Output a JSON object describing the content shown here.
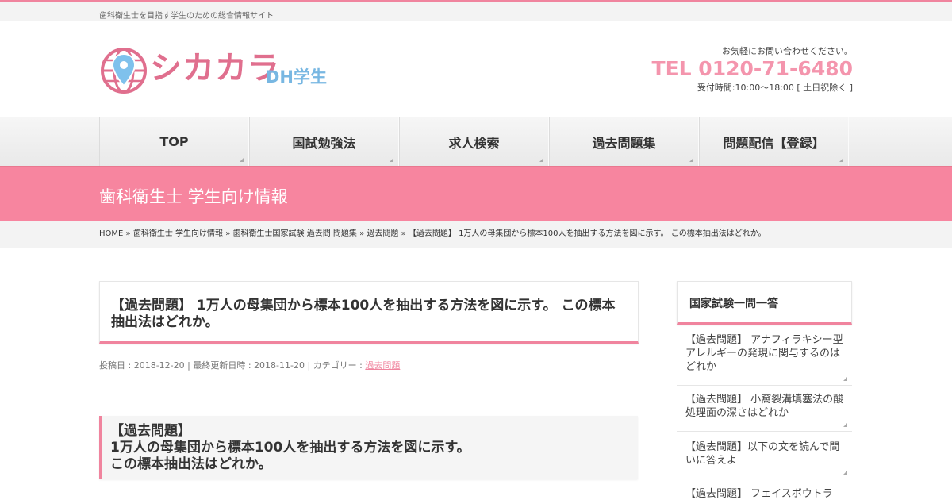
{
  "site": {
    "tagline": "歯科衛生士を目指す学生のための総合情報サイト",
    "logo_text": "シカカラ",
    "logo_sub": "DH学生",
    "brand_color": "#f0849e"
  },
  "contact": {
    "lead": "お気軽にお問い合わせください。",
    "tel": "TEL 0120-71-6480",
    "hours": "受付時間:10:00～18:00 [ 土日祝除く ]"
  },
  "nav": {
    "items": [
      {
        "label": "TOP"
      },
      {
        "label": "国試勉強法"
      },
      {
        "label": "求人検索"
      },
      {
        "label": "過去問題集"
      },
      {
        "label": "問題配信【登録】"
      }
    ]
  },
  "page": {
    "title": "歯科衛生士 学生向け情報"
  },
  "breadcrumb": {
    "items": [
      "HOME",
      "歯科衛生士 学生向け情報",
      "歯科衛生士国家試験 過去問 問題集",
      "過去問題",
      "【過去問題】 1万人の母集団から標本100人を抽出する方法を図に示す。 この標本抽出法はどれか。"
    ],
    "separator": "»"
  },
  "post": {
    "title": "【過去問題】 1万人の母集団から標本100人を抽出する方法を図に示す。 この標本抽出法はどれか。",
    "meta_prefix": "投稿日 : 2018-12-20 | 最終更新日時 : 2018-11-20 | カテゴリー : ",
    "category": "過去問題",
    "quote_lines": [
      "【過去問題】",
      "1万人の母集団から標本100人を抽出する方法を図に示す。",
      "この標本抽出法はどれか。"
    ]
  },
  "sidebar": {
    "title": "国家試験一問一答",
    "items": [
      {
        "label": "【過去問題】 アナフィラキシー型アレルギーの発現に関与するのはどれか"
      },
      {
        "label": "【過去問題】 小窩裂溝填塞法の酸処理面の深さはどれか"
      },
      {
        "label": "【過去問題】以下の文を読んで問いに答えよ"
      },
      {
        "label": "【過去問題】 フェイスボウトラ"
      }
    ]
  }
}
